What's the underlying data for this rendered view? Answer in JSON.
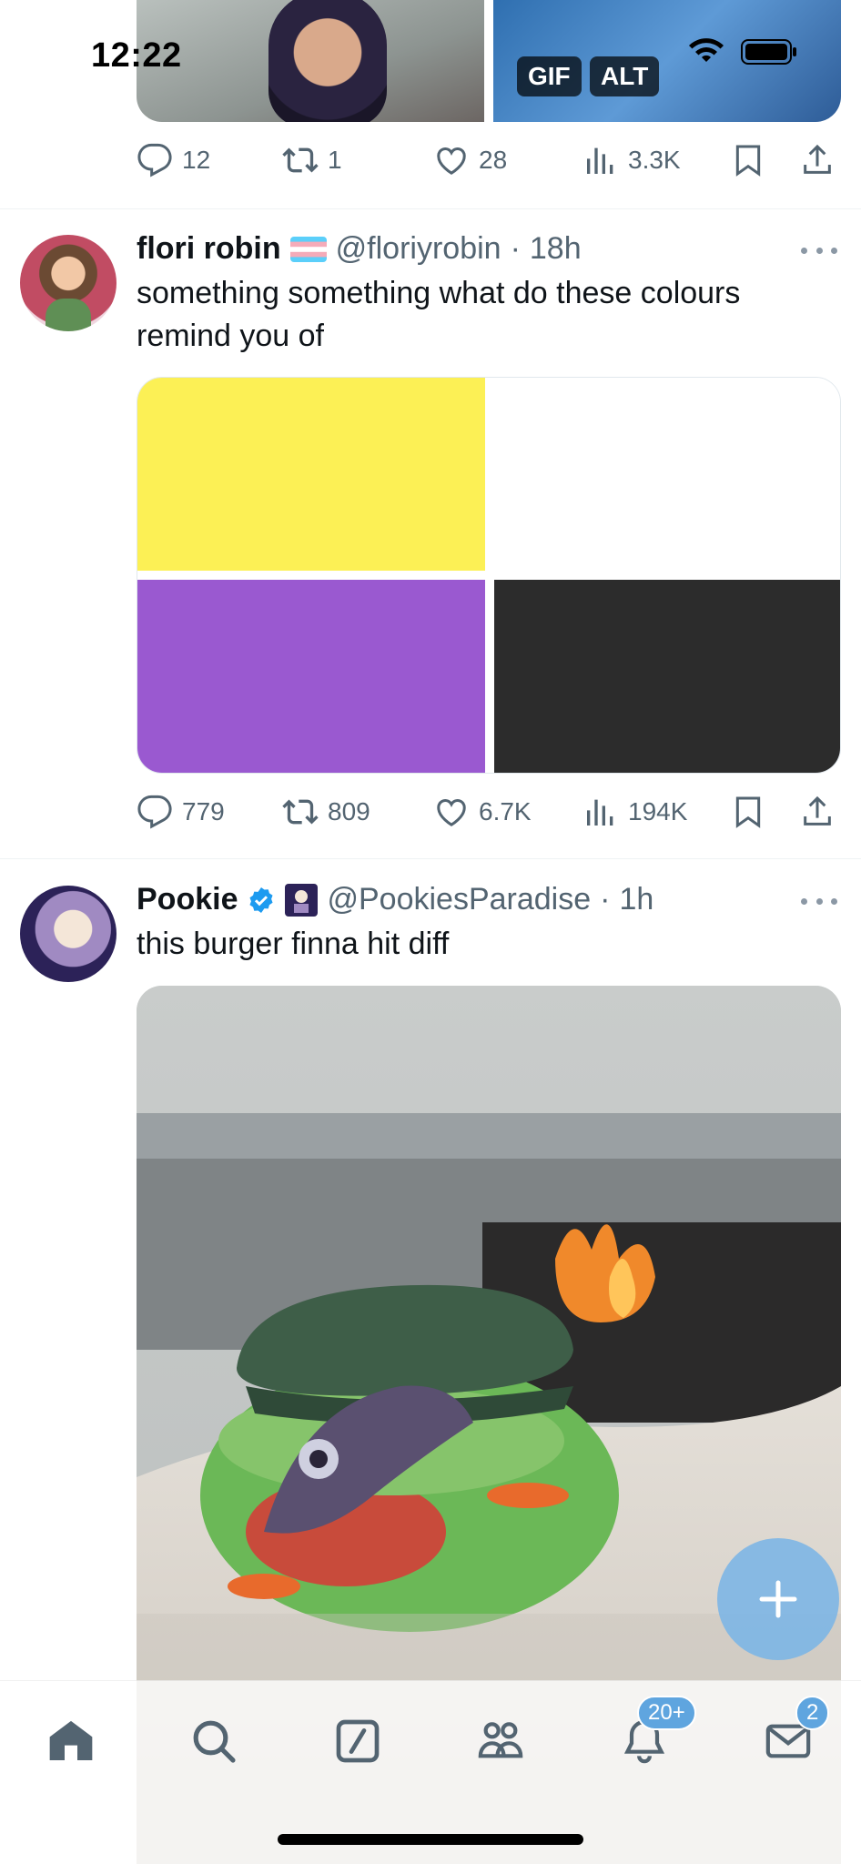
{
  "status_bar": {
    "time": "12:22"
  },
  "top_tweet": {
    "badges": {
      "gif": "GIF",
      "alt": "ALT"
    },
    "actions": {
      "replies": "12",
      "reposts": "1",
      "likes": "28",
      "views": "3.3K"
    }
  },
  "tweet1": {
    "name": "flori robin",
    "handle": "@floriyrobin",
    "time": "18h",
    "text": "something something what do these colours remind you of",
    "colors": [
      "#fcf055",
      "#ffffff",
      "#9a59d0",
      "#2c2c2c"
    ],
    "actions": {
      "replies": "779",
      "reposts": "809",
      "likes": "6.7K",
      "views": "194K"
    }
  },
  "tweet2": {
    "name": "Pookie",
    "handle": "@PookiesParadise",
    "time": "1h",
    "text": "this burger finna hit diff"
  },
  "nav": {
    "notifications_badge": "20+",
    "messages_badge": "2"
  },
  "colors": {
    "accent": "#1d9bf0",
    "icon_gray": "#536471"
  }
}
